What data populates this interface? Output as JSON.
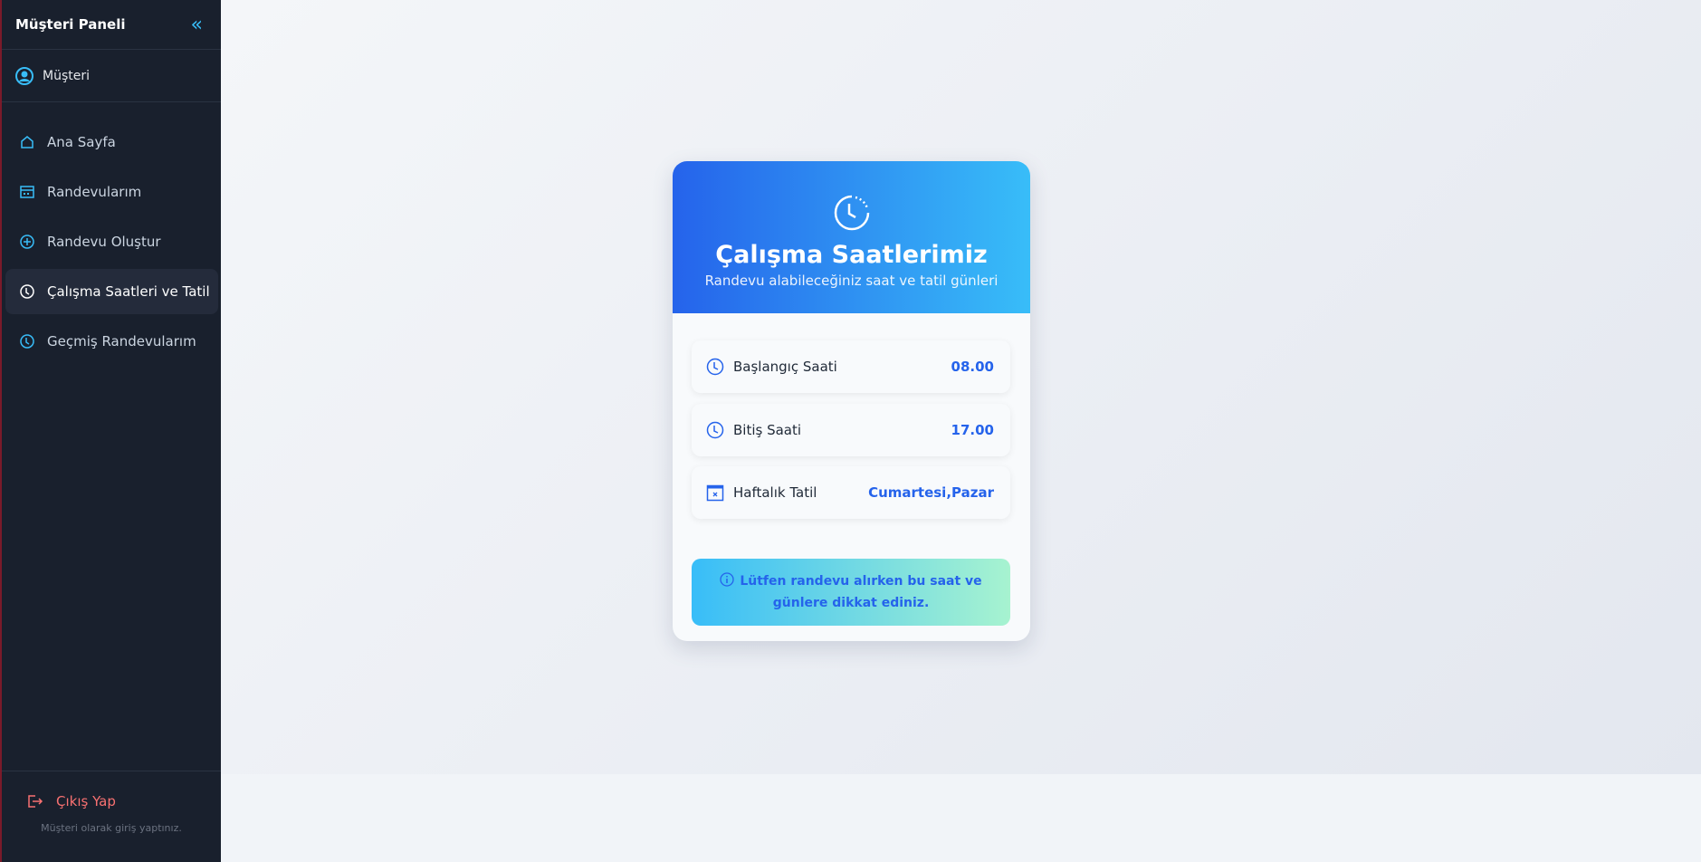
{
  "sidebar": {
    "title": "Müşteri Paneli",
    "user_role": "Müşteri",
    "items": [
      {
        "label": "Ana Sayfa",
        "icon": "home-icon"
      },
      {
        "label": "Randevularım",
        "icon": "calendar-icon"
      },
      {
        "label": "Randevu Oluştur",
        "icon": "plus-circle-icon"
      },
      {
        "label": "Çalışma Saatleri ve Tatil",
        "icon": "clock-icon",
        "active": true
      },
      {
        "label": "Geçmiş Randevularım",
        "icon": "history-icon"
      }
    ],
    "logout": "Çıkış Yap",
    "footer": "Müşteri olarak giriş yaptınız."
  },
  "card": {
    "title": "Çalışma Saatlerimiz",
    "subtitle": "Randevu alabileceğiniz saat ve tatil günleri",
    "rows": [
      {
        "label": "Başlangıç Saati",
        "value": "08.00"
      },
      {
        "label": "Bitiş Saati",
        "value": "17.00"
      },
      {
        "label": "Haftalık Tatil",
        "value": "Cumartesi,Pazar"
      }
    ],
    "info": "Lütfen randevu alırken bu saat ve günlere dikkat ediniz."
  },
  "colors": {
    "accent": "#2563eb",
    "sidebar": "#19202d",
    "logout": "#f87171",
    "icon": "#38bdf8"
  }
}
